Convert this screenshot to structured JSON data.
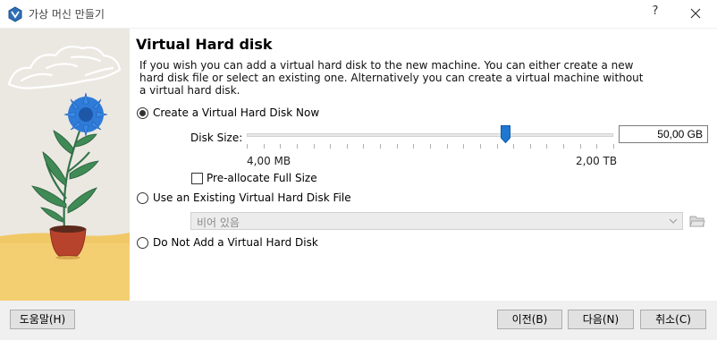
{
  "window": {
    "title": "가상 머신 만들기",
    "help_glyph": "?"
  },
  "page": {
    "heading": "Virtual Hard disk",
    "description": "If you wish you can add a virtual hard disk to the new machine. You can either create a new hard disk file or select an existing one. Alternatively you can create a virtual machine without a virtual hard disk."
  },
  "options": {
    "create_new": {
      "label": "Create a Virtual Hard Disk Now",
      "selected": true
    },
    "use_existing": {
      "label": "Use an Existing Virtual Hard Disk File",
      "selected": false
    },
    "none": {
      "label": "Do Not Add a Virtual Hard Disk",
      "selected": false
    }
  },
  "disk_size": {
    "label": "Disk Size:",
    "value_text": "50,00 GB",
    "min_label": "4,00 MB",
    "max_label": "2,00 TB",
    "slider_fraction": 0.7
  },
  "preallocate": {
    "label": "Pre-allocate Full Size",
    "checked": false
  },
  "existing_file": {
    "selected_value": "비어 있음",
    "enabled": false
  },
  "icons": {
    "app": "virtualbox-logo-icon",
    "close": "close-icon",
    "dropdown": "chevron-down-icon",
    "folder": "folder-open-icon"
  },
  "colors": {
    "slider_handle": "#1e78d2",
    "footer_bg": "#f0f0f0",
    "side_art_bg": "#ebe8e2"
  },
  "buttons": {
    "help": "도움말(H)",
    "back": "이전(B)",
    "next": "다음(N)",
    "cancel": "취소(C)"
  }
}
